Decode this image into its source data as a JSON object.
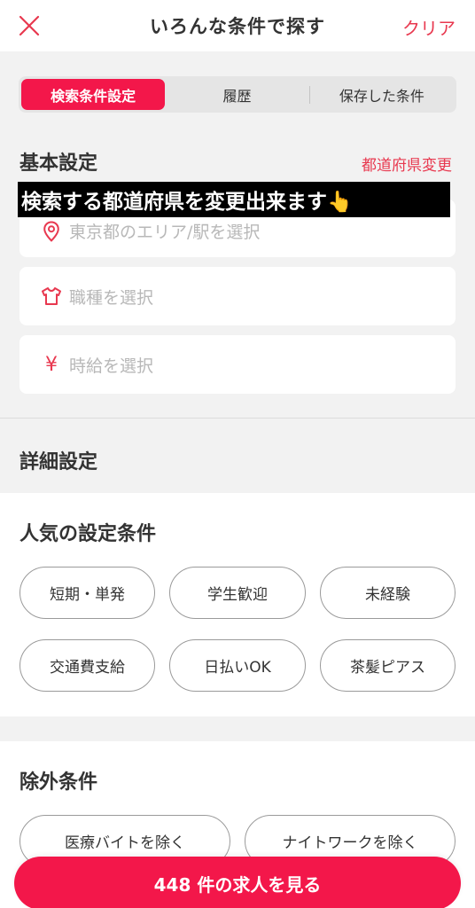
{
  "header": {
    "title": "いろんな条件で探す",
    "clear_label": "クリア"
  },
  "tabs": [
    {
      "label": "検索条件設定",
      "active": true
    },
    {
      "label": "履歴",
      "active": false
    },
    {
      "label": "保存した条件",
      "active": false
    }
  ],
  "basic": {
    "heading": "基本設定",
    "change_pref_label": "都道府県変更",
    "banner_text": "検索する都道府県を変更出来ます👆",
    "area_placeholder": "東京都のエリア/駅を選択",
    "job_placeholder": "職種を選択",
    "wage_placeholder": "時給を選択",
    "wage_icon": "¥"
  },
  "detail": {
    "heading": "詳細設定"
  },
  "popular": {
    "heading": "人気の設定条件",
    "chips": [
      "短期・単発",
      "学生歓迎",
      "未経験",
      "交通費支給",
      "日払いOK",
      "茶髪ピアス"
    ]
  },
  "exclude": {
    "heading": "除外条件",
    "chips": [
      "医療バイトを除く",
      "ナイトワークを除く"
    ]
  },
  "cta": {
    "label": "448 件の求人を見る"
  },
  "colors": {
    "accent": "#f3174a",
    "accent_text": "#e8384f"
  }
}
